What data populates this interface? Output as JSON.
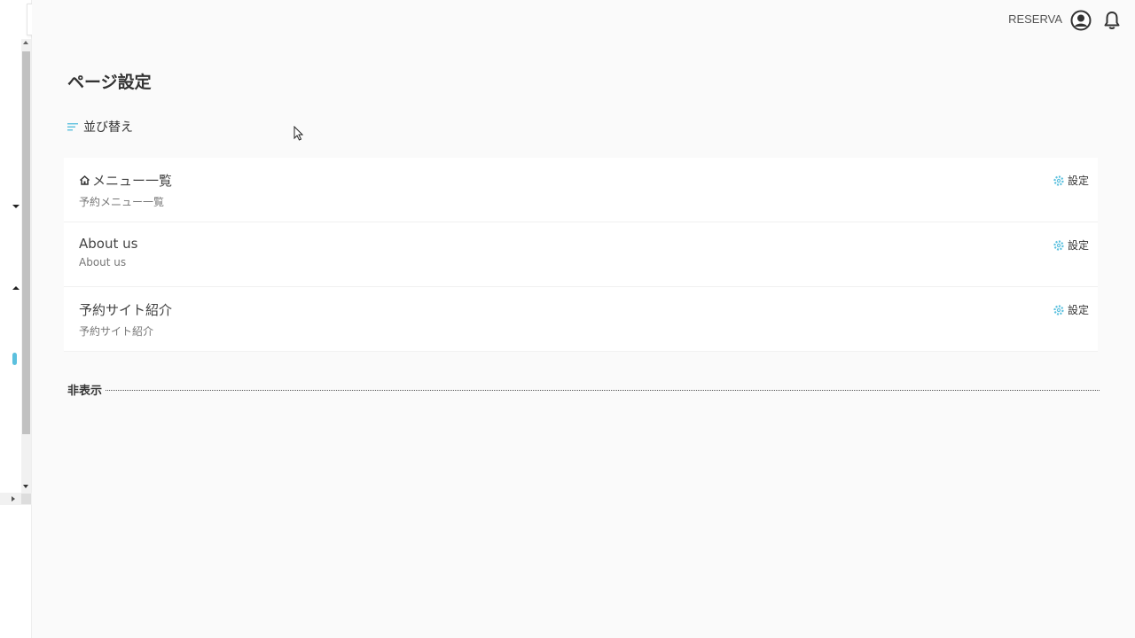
{
  "header": {
    "brand": "RESERVA",
    "icons": [
      "user-avatar-icon",
      "bell-icon"
    ]
  },
  "page": {
    "title": "ページ設定",
    "sort_label": "並び替え"
  },
  "pages": [
    {
      "title": "メニュー一覧",
      "subtitle": "予約メニュー一覧",
      "icon": "home-icon",
      "setting_label": "設定"
    },
    {
      "title": "About us",
      "subtitle": "About us",
      "setting_label": "設定"
    },
    {
      "title": "予約サイト紹介",
      "subtitle": "予約サイト紹介",
      "setting_label": "設定"
    }
  ],
  "hidden_section": {
    "label": "非表示"
  },
  "colors": {
    "accent": "#5bc0de",
    "background": "#fafafa"
  }
}
